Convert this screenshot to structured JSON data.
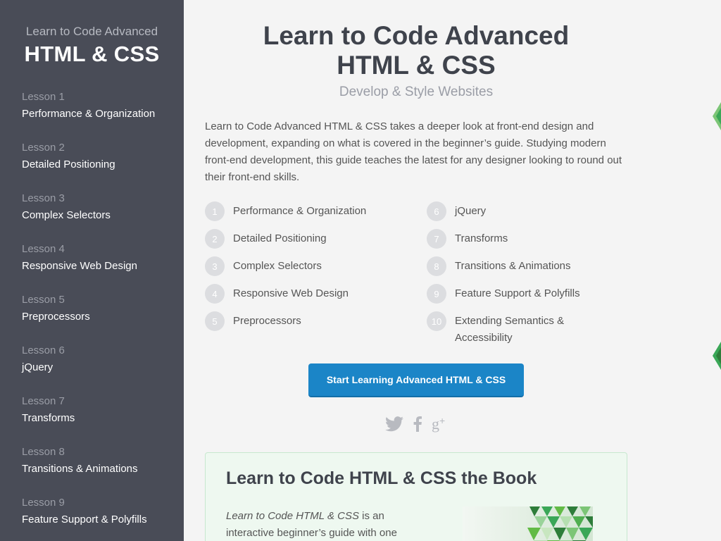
{
  "sidebar": {
    "subtitle": "Learn to Code Advanced",
    "title": "HTML & CSS",
    "lessons": [
      {
        "num": "Lesson 1",
        "title": "Performance & Organization"
      },
      {
        "num": "Lesson 2",
        "title": "Detailed Positioning"
      },
      {
        "num": "Lesson 3",
        "title": "Complex Selectors"
      },
      {
        "num": "Lesson 4",
        "title": "Responsive Web Design"
      },
      {
        "num": "Lesson 5",
        "title": "Preprocessors"
      },
      {
        "num": "Lesson 6",
        "title": "jQuery"
      },
      {
        "num": "Lesson 7",
        "title": "Transforms"
      },
      {
        "num": "Lesson 8",
        "title": "Transitions & Animations"
      },
      {
        "num": "Lesson 9",
        "title": "Feature Support & Polyfills"
      }
    ]
  },
  "main": {
    "title_line1": "Learn to Code Advanced",
    "title_line2": "HTML & CSS",
    "subtitle": "Develop & Style Websites",
    "intro": "Learn to Code Advanced HTML & CSS takes a deeper look at front-end design and development, expanding on what is covered in the beginner’s guide. Studying modern front-end development, this guide teaches the latest for any designer looking to round out their front-end skills.",
    "lesson_list": [
      {
        "n": "1",
        "label": "Performance & Organization"
      },
      {
        "n": "2",
        "label": "Detailed Positioning"
      },
      {
        "n": "3",
        "label": "Complex Selectors"
      },
      {
        "n": "4",
        "label": "Responsive Web Design"
      },
      {
        "n": "5",
        "label": "Preprocessors"
      },
      {
        "n": "6",
        "label": "jQuery"
      },
      {
        "n": "7",
        "label": "Transforms"
      },
      {
        "n": "8",
        "label": "Transitions & Animations"
      },
      {
        "n": "9",
        "label": "Feature Support & Polyfills"
      },
      {
        "n": "10",
        "label": "Extending Semantics & Accessibility"
      }
    ],
    "cta_label": "Start Learning Advanced HTML & CSS",
    "social": {
      "twitter": "twitter-icon",
      "facebook": "facebook-icon",
      "googleplus": "google-plus-icon"
    },
    "book": {
      "title": "Learn to Code HTML & CSS the Book",
      "text_italic": "Learn to Code HTML & CSS",
      "text_rest": " is an interactive beginner’s guide with one"
    }
  },
  "colors": {
    "sidebar_bg": "#494c57",
    "cta_bg": "#1b85c7",
    "accent_green": "#3aa757"
  }
}
